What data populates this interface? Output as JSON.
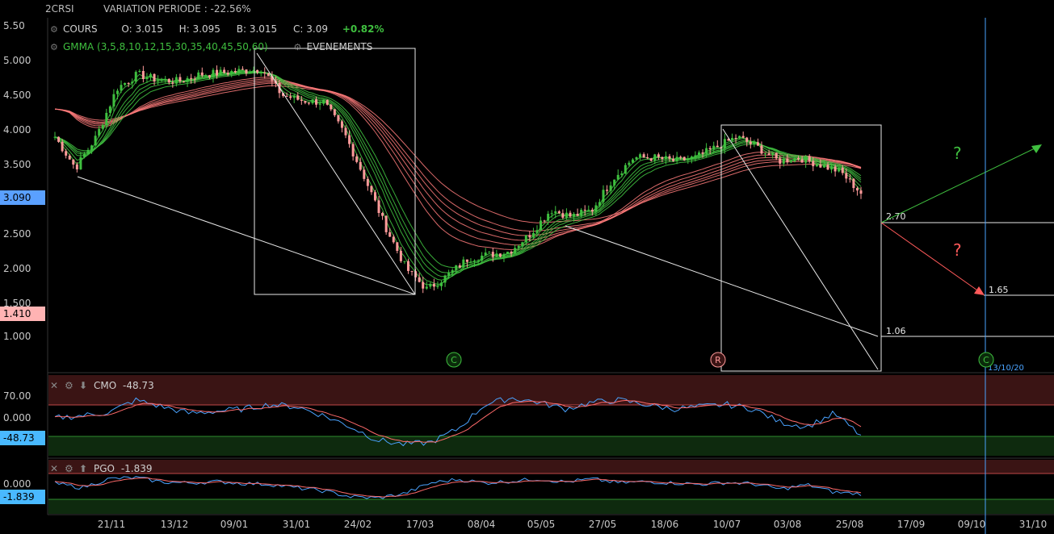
{
  "header": {
    "symbol": "2CRSI",
    "variation": "VARIATION PERIODE : -22.56%"
  },
  "quote": {
    "label": "COURS",
    "open": "O: 3.015",
    "high": "H: 3.095",
    "low": "B: 3.015",
    "close": "C: 3.09",
    "change": "+0.82%"
  },
  "indicators": {
    "gmma": "GMMA (3,5,8,10,12,15,30,35,40,45,50,60)",
    "events": "EVENEMENTS"
  },
  "badges": {
    "last_price": "3.090",
    "low_price": "1.410",
    "cmo_value": "-48.73",
    "pgo_value": "-1.839"
  },
  "colors": {
    "up": "#3fbf3f",
    "down": "#ff9a9a",
    "short_ma": "#3fbf3f",
    "long_ma": "#ff7b7b",
    "oscillator": "#4aa3ff",
    "signal": "#ff6a6a",
    "price_badge": "#5aa0ff",
    "low_badge": "#ffb3b3"
  },
  "chart_data": [
    {
      "type": "candlestick",
      "title": "",
      "y_ticks": [
        "5.50",
        "5.000",
        "4.500",
        "4.000",
        "3.500",
        "3.000",
        "2.500",
        "2.000",
        "1.500",
        "1.000"
      ],
      "x_ticks": [
        "21/11",
        "13/12",
        "09/01",
        "31/01",
        "24/02",
        "17/03",
        "08/04",
        "05/05",
        "27/05",
        "18/06",
        "10/07",
        "03/08",
        "25/08",
        "17/09",
        "09/10",
        "31/10"
      ],
      "ylim": [
        0.6,
        5.6
      ],
      "close_path": [
        {
          "date": "01/11",
          "value": 3.9
        },
        {
          "date": "08/11",
          "value": 3.45
        },
        {
          "date": "15/11",
          "value": 3.9
        },
        {
          "date": "21/11",
          "value": 4.6
        },
        {
          "date": "29/11",
          "value": 4.8
        },
        {
          "date": "06/12",
          "value": 4.72
        },
        {
          "date": "13/12",
          "value": 4.7
        },
        {
          "date": "23/12",
          "value": 4.8
        },
        {
          "date": "03/01",
          "value": 4.82
        },
        {
          "date": "09/01",
          "value": 4.85
        },
        {
          "date": "16/01",
          "value": 4.88
        },
        {
          "date": "22/01",
          "value": 4.5
        },
        {
          "date": "31/01",
          "value": 4.42
        },
        {
          "date": "10/02",
          "value": 4.4
        },
        {
          "date": "17/02",
          "value": 3.95
        },
        {
          "date": "24/02",
          "value": 3.3
        },
        {
          "date": "03/03",
          "value": 2.6
        },
        {
          "date": "10/03",
          "value": 2.0
        },
        {
          "date": "17/03",
          "value": 1.7
        },
        {
          "date": "24/03",
          "value": 1.9
        },
        {
          "date": "31/03",
          "value": 2.15
        },
        {
          "date": "08/04",
          "value": 2.2
        },
        {
          "date": "17/04",
          "value": 2.25
        },
        {
          "date": "28/04",
          "value": 2.5
        },
        {
          "date": "05/05",
          "value": 2.85
        },
        {
          "date": "12/05",
          "value": 2.75
        },
        {
          "date": "19/05",
          "value": 2.85
        },
        {
          "date": "27/05",
          "value": 3.3
        },
        {
          "date": "03/06",
          "value": 3.6
        },
        {
          "date": "10/06",
          "value": 3.6
        },
        {
          "date": "18/06",
          "value": 3.55
        },
        {
          "date": "25/06",
          "value": 3.6
        },
        {
          "date": "02/07",
          "value": 3.75
        },
        {
          "date": "10/07",
          "value": 3.9
        },
        {
          "date": "17/07",
          "value": 3.75
        },
        {
          "date": "24/07",
          "value": 3.55
        },
        {
          "date": "03/08",
          "value": 3.6
        },
        {
          "date": "10/08",
          "value": 3.5
        },
        {
          "date": "17/08",
          "value": 3.4
        },
        {
          "date": "25/08",
          "value": 3.09
        }
      ],
      "annotations": {
        "levels": [
          "2.70",
          "1.65",
          "1.06"
        ],
        "question_marks": [
          "?",
          "?"
        ],
        "events": [
          "C",
          "R",
          "C"
        ],
        "event_date": "13/10/20"
      }
    },
    {
      "type": "line",
      "title": "CMO",
      "value_label": "-48.73",
      "y_ticks": [
        "70.00",
        "0.000"
      ],
      "ylim": [
        -100,
        100
      ],
      "series": [
        {
          "name": "CMO",
          "values": [
            0,
            5,
            12,
            40,
            25,
            10,
            15,
            20,
            30,
            25,
            5,
            -20,
            -50,
            -60,
            -55,
            -25,
            30,
            45,
            35,
            20,
            35,
            40,
            30,
            20,
            25,
            30,
            20,
            -10,
            -20,
            10,
            -40
          ]
        }
      ]
    },
    {
      "type": "line",
      "title": "PGO",
      "value_label": "-1.839",
      "y_ticks": [
        "0.000"
      ],
      "ylim": [
        -4,
        4
      ],
      "series": [
        {
          "name": "PGO",
          "values": [
            0.5,
            -0.5,
            1.5,
            1.8,
            0.8,
            0.6,
            0.9,
            0.5,
            0.3,
            -0.5,
            -1.2,
            -2.5,
            -2.8,
            -1.8,
            0.6,
            1.4,
            0.6,
            1.0,
            1.5,
            0.8,
            1.5,
            0.6,
            0.9,
            0.6,
            0.3,
            0.7,
            0.4,
            -0.8,
            0.2,
            -1.5,
            -1.84
          ]
        }
      ]
    }
  ]
}
